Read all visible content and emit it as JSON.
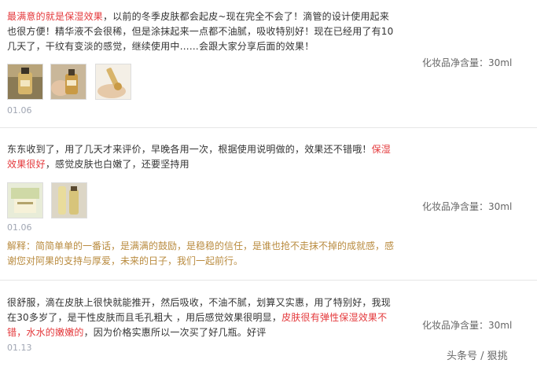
{
  "reviews": [
    {
      "segments": [
        {
          "text": "最满意的就是保湿效果",
          "highlight": true
        },
        {
          "text": "，以前的冬季皮肤都会起皮~现在完全不会了！滴管的设计使用起来也很方便！精华液不会很稀，但是涂抹起来一点都不油腻，吸收特别好！现在已经用了有10几天了，干纹有变淡的感觉，继续使用中……会跟大家分享后面的效果！",
          "highlight": false
        }
      ],
      "spec_label": "化妆品净含量：30ml",
      "thumbnails": [
        "bottle-photo-gold",
        "bottle-photo-hand",
        "bottle-photo-dropper"
      ],
      "date": "01.06"
    },
    {
      "segments": [
        {
          "text": "东东收到了，用了几天才来评价，早晚各用一次，根据使用说明做的，效果还不错哦！",
          "highlight": false
        },
        {
          "text": "保湿效果很好",
          "highlight": true
        },
        {
          "text": "，感觉皮肤也白嫩了，还要坚持用",
          "highlight": false
        }
      ],
      "spec_label": "化妆品净含量：30ml",
      "thumbnails": [
        "box-photo-green",
        "bottle-photo-tube"
      ],
      "date": "01.06",
      "reply": "解释：简简单单的一番话，是满满的鼓励，是稳稳的信任，是谁也抢不走抹不掉的成就感，感谢您对阿果的支持与厚爱，未来的日子，我们一起前行。"
    },
    {
      "segments": [
        {
          "text": "很舒服，滴在皮肤上很快就能推开，然后吸收，不油不腻，划算又实惠，用了特别好，我现在30多岁了，是干性皮肤而且毛孔粗大 ，用后感觉效果很明显，",
          "highlight": false
        },
        {
          "text": "皮肤很有弹性保湿效果不错，水水的嫩嫩的",
          "highlight": true
        },
        {
          "text": "，因为价格实惠所以一次买了好几瓶。好评",
          "highlight": false
        }
      ],
      "spec_label": "化妆品净含量：30ml",
      "date": "01.13"
    }
  ],
  "watermark": "头条号 / 狠挑",
  "colors": {
    "highlight": "#e4393c",
    "reply_text": "#b98b3f",
    "date": "#a0a6b3",
    "divider": "#e6e6e6"
  }
}
